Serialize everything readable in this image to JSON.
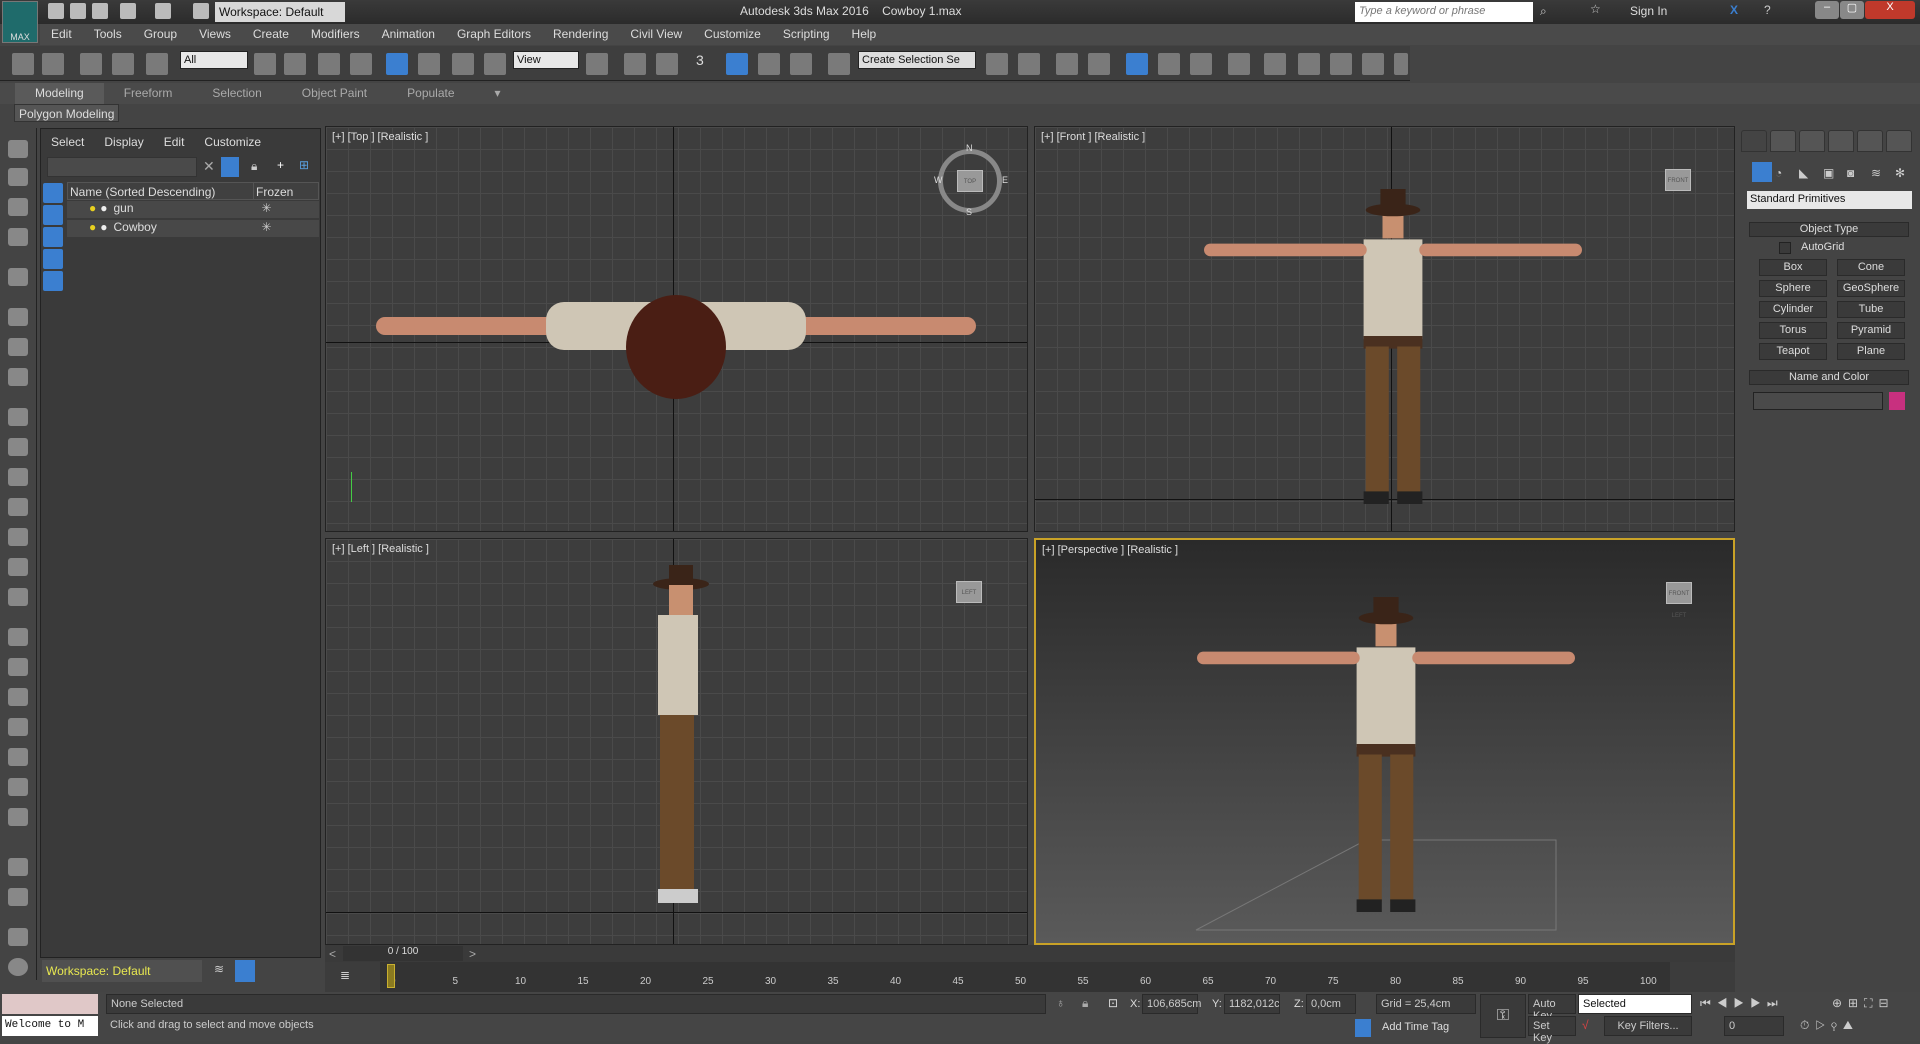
{
  "title_bar": {
    "workspace": "Workspace: Default",
    "app_title": "Autodesk 3ds Max 2016",
    "file_name": "Cowboy 1.max",
    "search_placeholder": "Type a keyword or phrase",
    "sign_in": "Sign In",
    "logo_text": "MAX"
  },
  "menu": [
    "Edit",
    "Tools",
    "Group",
    "Views",
    "Create",
    "Modifiers",
    "Animation",
    "Graph Editors",
    "Rendering",
    "Civil View",
    "Customize",
    "Scripting",
    "Help"
  ],
  "toolbar": {
    "selection_filter": "All",
    "ref_coord": "View",
    "named_selection": "Create Selection Se",
    "snap_value": "3",
    "accent": "#3b7fd0"
  },
  "ribbon": {
    "tabs": [
      "Modeling",
      "Freeform",
      "Selection",
      "Object Paint",
      "Populate"
    ],
    "active": "Modeling",
    "panel": "Polygon Modeling"
  },
  "scene_explorer": {
    "menu": [
      "Select",
      "Display",
      "Edit",
      "Customize"
    ],
    "col_name": "Name (Sorted Descending)",
    "col_frozen": "Frozen",
    "items": [
      {
        "name": "gun"
      },
      {
        "name": "Cowboy"
      }
    ],
    "workspace": "Workspace: Default"
  },
  "viewports": [
    {
      "label": "[+] [Top ] [Realistic ]",
      "cube": "TOP",
      "compass": [
        "N",
        "S",
        "E",
        "W"
      ]
    },
    {
      "label": "[+] [Front ] [Realistic ]",
      "cube": "FRONT"
    },
    {
      "label": "[+] [Left ] [Realistic ]",
      "cube": "LEFT"
    },
    {
      "label": "[+] [Perspective ] [Realistic ]",
      "cube": "FRONT LEFT",
      "active": true,
      "border_color": "#c9a227"
    }
  ],
  "command_panel": {
    "category": "Standard Primitives",
    "object_type_title": "Object Type",
    "autogrid": "AutoGrid",
    "buttons": [
      "Box",
      "Cone",
      "Sphere",
      "GeoSphere",
      "Cylinder",
      "Tube",
      "Torus",
      "Pyramid",
      "Teapot",
      "Plane"
    ],
    "name_color_title": "Name and Color",
    "name_value": "",
    "color": "#c8307f"
  },
  "timeline": {
    "frame_display": "0 / 100",
    "current_frame": 0,
    "ticks": [
      "0",
      "5",
      "10",
      "15",
      "20",
      "25",
      "30",
      "35",
      "40",
      "45",
      "50",
      "55",
      "60",
      "65",
      "70",
      "75",
      "80",
      "85",
      "90",
      "95",
      "100"
    ]
  },
  "status": {
    "listener": "Welcome to M",
    "selection": "None Selected",
    "prompt": "Click and drag to select and move objects",
    "x_label": "X:",
    "x": "106,685cm",
    "y_label": "Y:",
    "y": "1182,012cm",
    "z_label": "Z:",
    "z": "0,0cm",
    "grid": "Grid = 25,4cm",
    "add_time_tag": "Add Time Tag",
    "auto_key": "Auto Key",
    "set_key": "Set Key",
    "key_mode": "Selected",
    "key_filters": "Key Filters...",
    "frame": "0"
  }
}
